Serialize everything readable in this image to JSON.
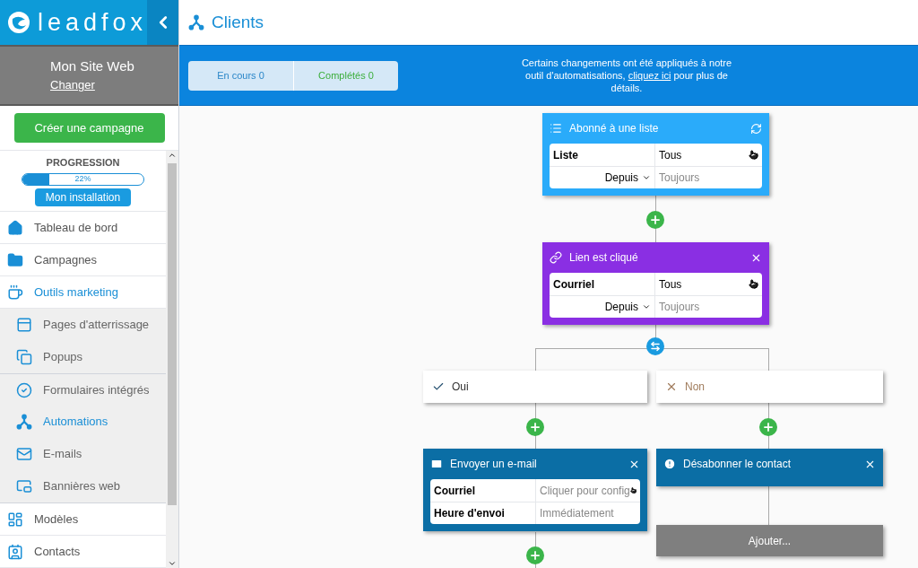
{
  "sidebar": {
    "logo": "leadfox",
    "site": {
      "name": "Mon Site Web",
      "change_link": "Changer"
    },
    "create_button": "Créer une campagne",
    "progress": {
      "title": "PROGRESSION",
      "level": 0.22,
      "reading": "22%",
      "button": "Mon installation"
    },
    "nav": [
      {
        "label": "Tableau de bord",
        "selected": false
      },
      {
        "label": "Campagnes",
        "selected": false
      },
      {
        "label": "Outils marketing",
        "selected": true,
        "expanded": true,
        "children": [
          {
            "label": "Pages d'atterrissage",
            "selected": false
          },
          {
            "label": "Popups",
            "selected": false
          },
          {
            "label": "Formulaires intégrés",
            "selected": false
          },
          {
            "label": "Automations",
            "selected": true
          },
          {
            "label": "E-mails",
            "selected": false
          },
          {
            "label": "Bannières web",
            "selected": false
          }
        ]
      },
      {
        "label": "Modèles",
        "selected": false
      },
      {
        "label": "Contacts",
        "selected": false
      }
    ]
  },
  "page": {
    "title": "Clients"
  },
  "banner": {
    "tabs": [
      {
        "label": "En cours 0",
        "color": "#2a86c8"
      },
      {
        "label": "Complétés 0",
        "color": "#3cae3c"
      }
    ],
    "notice": {
      "before": "Certains changements ont été appliqués à notre outil d'automatisations, ",
      "link": "cliquez ici",
      "after": " pour plus de détails."
    }
  },
  "canvas": {
    "nodes": [
      {
        "kind": "step",
        "title": "Abonné à une liste",
        "color": "#2aabfa",
        "refreshable": true,
        "closable": false,
        "rows": [
          {
            "kind": "field",
            "label": "Liste",
            "value": "Tous",
            "muted": false,
            "pick": true
          },
          {
            "kind": "dropdown",
            "label": "Depuis",
            "value": "Toujours",
            "muted": true,
            "pick": false
          }
        ]
      },
      {
        "kind": "step",
        "title": "Lien est cliqué",
        "color": "#8a2fe3",
        "refreshable": false,
        "closable": true,
        "rows": [
          {
            "kind": "field",
            "label": "Courriel",
            "value": "Tous",
            "muted": false,
            "pick": true
          },
          {
            "kind": "dropdown",
            "label": "Depuis",
            "value": "Toujours",
            "muted": true,
            "pick": false
          }
        ]
      },
      {
        "kind": "yes",
        "label": "Oui"
      },
      {
        "kind": "no",
        "label": "Non"
      },
      {
        "kind": "step",
        "title": "Envoyer un e-mail",
        "color": "#0b6ea5",
        "refreshable": false,
        "closable": true,
        "rows": [
          {
            "kind": "field",
            "label": "Courriel",
            "value": "Cliquer pour config",
            "muted": true,
            "pick": true
          },
          {
            "kind": "field",
            "label": "Heure d'envoi",
            "value": "Immédiatement",
            "muted": true,
            "pick": false
          }
        ]
      },
      {
        "kind": "step",
        "title": "Désabonner le contact",
        "color": "#0b6ea5",
        "refreshable": false,
        "closable": true
      },
      {
        "kind": "add",
        "label": "Ajouter..."
      }
    ]
  }
}
